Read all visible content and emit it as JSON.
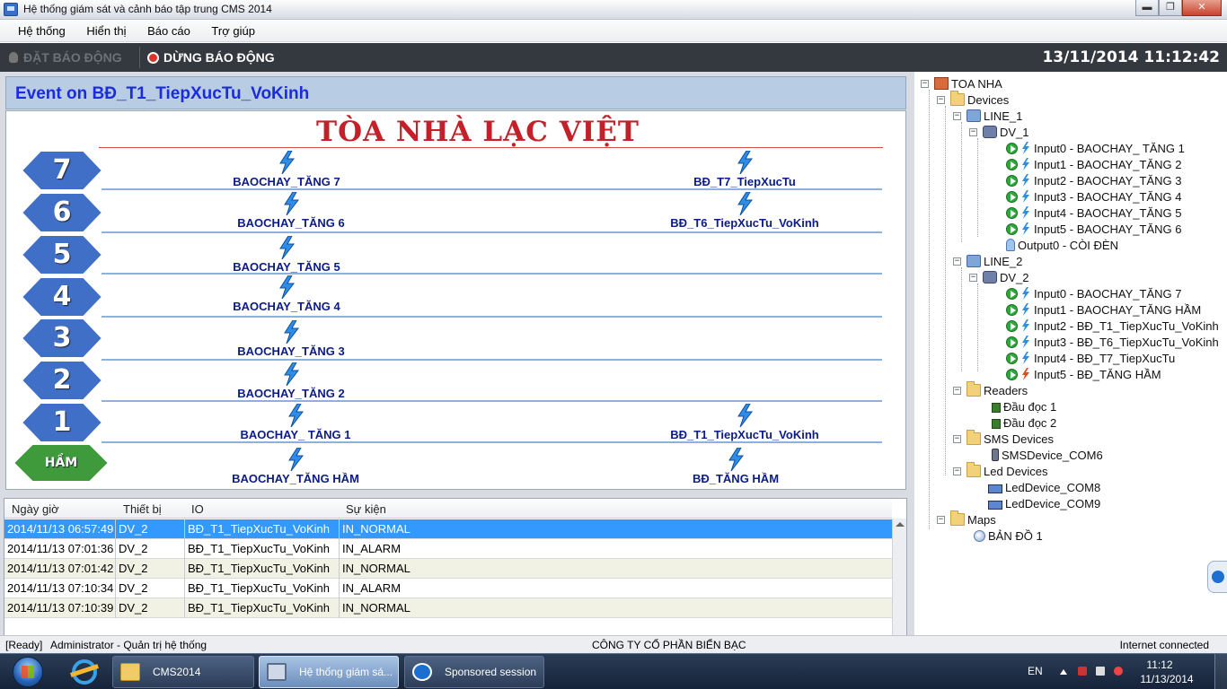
{
  "window": {
    "title": "Hệ thống giám sát và cảnh báo tập trung CMS 2014",
    "minimize": "▬",
    "maximize": "❐",
    "close": "✕"
  },
  "menu": [
    "Hệ thống",
    "Hiển thị",
    "Báo cáo",
    "Trợ giúp"
  ],
  "toolbar": {
    "set_alarm": "ĐẶT BÁO ĐỘNG",
    "stop_alarm": "DỪNG BÁO ĐỘNG",
    "datetime": "13/11/2014 11:12:42"
  },
  "event_header": "Event on BĐ_T1_TiepXucTu_VoKinh",
  "map": {
    "building_name": "TÒA NHÀ LẠC VIỆT",
    "floors": [
      "7",
      "6",
      "5",
      "4",
      "3",
      "2",
      "1",
      "HẦM"
    ],
    "sensors": {
      "f7_left": "BAOCHAY_TĂNG 7",
      "f7_right": "BĐ_T7_TiepXucTu",
      "f6_left": "BAOCHAY_TĂNG 6",
      "f6_right": "BĐ_T6_TiepXucTu_VoKinh",
      "f5_left": "BAOCHAY_TĂNG 5",
      "f4_left": "BAOCHAY_TĂNG 4",
      "f3_left": "BAOCHAY_TĂNG 3",
      "f2_left": "BAOCHAY_TĂNG 2",
      "f1_left": "BAOCHAY_ TĂNG 1",
      "f1_right": "BĐ_T1_TiepXucTu_VoKinh",
      "ham_left": "BAOCHAY_TĂNG HẦM",
      "ham_right": "BĐ_TĂNG HẦM"
    }
  },
  "grid": {
    "columns": [
      "Ngày giờ",
      "Thiết bị",
      "IO",
      "Sự kiện"
    ],
    "rows": [
      {
        "time": "2014/11/13 06:57:49",
        "device": "DV_2",
        "io": "BĐ_T1_TiepXucTu_VoKinh",
        "event": "IN_NORMAL"
      },
      {
        "time": "2014/11/13 07:01:36",
        "device": "DV_2",
        "io": "BĐ_T1_TiepXucTu_VoKinh",
        "event": "IN_ALARM"
      },
      {
        "time": "2014/11/13 07:01:42",
        "device": "DV_2",
        "io": "BĐ_T1_TiepXucTu_VoKinh",
        "event": "IN_NORMAL"
      },
      {
        "time": "2014/11/13 07:10:34",
        "device": "DV_2",
        "io": "BĐ_T1_TiepXucTu_VoKinh",
        "event": "IN_ALARM"
      },
      {
        "time": "2014/11/13 07:10:39",
        "device": "DV_2",
        "io": "BĐ_T1_TiepXucTu_VoKinh",
        "event": "IN_NORMAL"
      }
    ]
  },
  "tree": {
    "root": "TOA NHA",
    "devices": "Devices",
    "line1": "LINE_1",
    "dv1": "DV_1",
    "dv1_inputs": [
      "Input0 - BAOCHAY_ TĂNG 1",
      "Input1 - BAOCHAY_TĂNG 2",
      "Input2 - BAOCHAY_TĂNG 3",
      "Input3 - BAOCHAY_TĂNG 4",
      "Input4 - BAOCHAY_TĂNG 5",
      "Input5 - BAOCHAY_TĂNG 6"
    ],
    "dv1_output": "Output0 - CÒI ĐÈN",
    "line2": "LINE_2",
    "dv2": "DV_2",
    "dv2_inputs": [
      "Input0 - BAOCHAY_TĂNG 7",
      "Input1 - BAOCHAY_TĂNG HẦM",
      "Input2 - BĐ_T1_TiepXucTu_VoKinh",
      "Input3 - BĐ_T6_TiepXucTu_VoKinh",
      "Input4 - BĐ_T7_TiepXucTu",
      "Input5 - BĐ_TĂNG HẦM"
    ],
    "readers": "Readers",
    "reader_items": [
      "Đầu đọc 1",
      "Đầu đọc 2"
    ],
    "sms_devices": "SMS Devices",
    "sms_items": [
      "SMSDevice_COM6"
    ],
    "led_devices": "Led Devices",
    "led_items": [
      "LedDevice_COM8",
      "LedDevice_COM9"
    ],
    "maps": "Maps",
    "map_items": [
      "BẢN ĐỒ 1"
    ]
  },
  "status": {
    "ready": "[Ready]",
    "user": "Administrator - Quản trị hệ thống",
    "company": "CÔNG TY CỔ PHẦN BIỂN BẠC",
    "connection": "Internet connected"
  },
  "taskbar": {
    "tasks": [
      "CMS2014",
      "Hệ thống giám sá...",
      "Sponsored session"
    ],
    "lang": "EN",
    "time": "11:12",
    "date": "11/13/2014"
  },
  "colors": {
    "accent_blue": "#1b2ddb",
    "building_red": "#c4202a",
    "badge_blue": "#3f6fc6",
    "badge_green": "#3f9a3c",
    "selected_row": "#3399ff"
  }
}
